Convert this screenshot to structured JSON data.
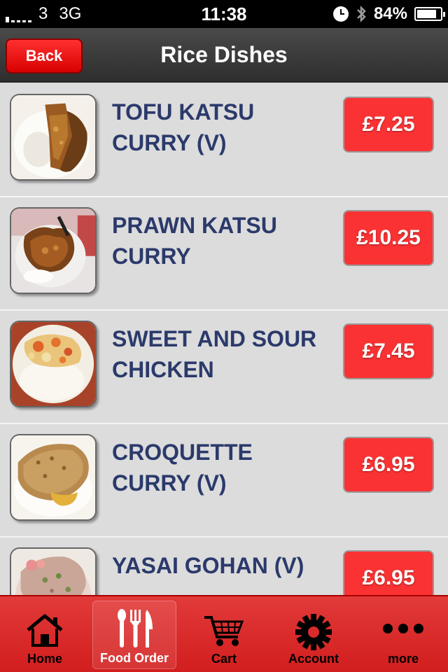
{
  "status_bar": {
    "carrier": "3",
    "network": "3G",
    "time": "11:38",
    "battery": "84%",
    "battery_level": 0.84
  },
  "nav": {
    "back_label": "Back",
    "title": "Rice Dishes"
  },
  "items": [
    {
      "name": "TOFU KATSU CURRY (V)",
      "price": "£7.25"
    },
    {
      "name": "PRAWN KATSU CURRY",
      "price": "£10.25"
    },
    {
      "name": "SWEET AND SOUR CHICKEN",
      "price": "£7.45"
    },
    {
      "name": "CROQUETTE CURRY (V)",
      "price": "£6.95"
    },
    {
      "name": "YASAI GOHAN (V)",
      "price": "£6.95"
    }
  ],
  "tabs": [
    {
      "label": "Home",
      "icon": "home-icon"
    },
    {
      "label": "Food Order",
      "icon": "cutlery-icon",
      "active": true
    },
    {
      "label": "Cart",
      "icon": "cart-icon"
    },
    {
      "label": "Account",
      "icon": "gear-icon"
    },
    {
      "label": "more",
      "icon": "more-icon"
    }
  ],
  "colors": {
    "accent_red": "#fb3233",
    "dish_text": "#2b3a6b",
    "nav_bar": "#3a3a3a",
    "tab_bar": "#d92b2b"
  }
}
